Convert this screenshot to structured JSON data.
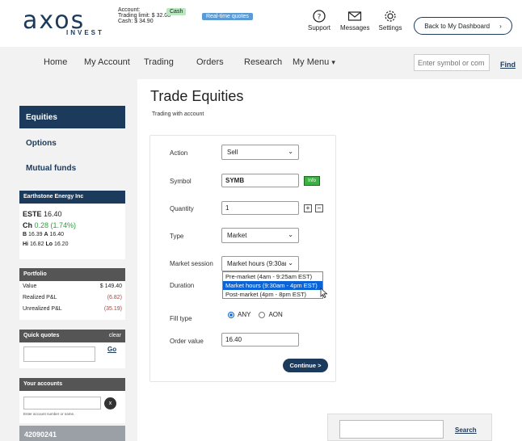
{
  "header": {
    "logo_text": "axos",
    "logo_sub": "INVEST",
    "account_label": "Account:",
    "trading_limit": "Trading limit: $ 32.08",
    "cash": "Cash: $ 34.90",
    "cash_badge": "Cash",
    "realtime_badge": "Real-time quotes",
    "support": "Support",
    "messages": "Messages",
    "settings": "Settings",
    "back_button": "Back to My Dashboard",
    "back_chevron": "›"
  },
  "nav": {
    "items": [
      "Home",
      "My Account",
      "Trading",
      "Orders",
      "Research",
      "My Menu"
    ],
    "menu_caret": "▾",
    "search_placeholder": "Enter symbol or com",
    "find": "Find"
  },
  "sidebar": {
    "items": [
      "Equities",
      "Options",
      "Mutual funds"
    ],
    "quote": {
      "header": "Earthstone Energy Inc",
      "symbol": "ESTE",
      "price": "16.40",
      "change_label": "Ch",
      "change": "0.28 (1.74%)",
      "bid_label": "B",
      "bid": "16.39",
      "ask_label": "A",
      "ask": "16.40",
      "hi_label": "Hi",
      "hi": "16.82",
      "lo_label": "Lo",
      "lo": "16.20"
    },
    "portfolio": {
      "header": "Portfolio",
      "rows": [
        {
          "label": "Value",
          "value": "$ 149.40"
        },
        {
          "label": "Realized P&L",
          "value": "(6.82)"
        },
        {
          "label": "Unrealized P&L",
          "value": "(35.19)"
        }
      ]
    },
    "quick_quotes": {
      "header": "Quick quotes",
      "clear": "clear",
      "go": "Go"
    },
    "your_accounts": {
      "header": "Your accounts",
      "clear_icon": "x",
      "hint": "Enter account number or name.",
      "account_number": "42090241"
    }
  },
  "main": {
    "title": "Trade Equities",
    "subtitle": "Trading with account",
    "form": {
      "action_label": "Action",
      "action_value": "Sell",
      "symbol_label": "Symbol",
      "symbol_value": "SYMB",
      "info_button": "Info",
      "quantity_label": "Quantity",
      "quantity_value": "1",
      "plus": "+",
      "minus": "−",
      "type_label": "Type",
      "type_value": "Market",
      "session_label": "Market session",
      "session_value": "Market hours (9:30am",
      "session_options": [
        "Pre-market (4am - 9:25am EST)",
        "Market hours (9:30am - 4pm EST)",
        "Post-market (4pm - 8pm EST)"
      ],
      "session_selected_index": 1,
      "duration_label": "Duration",
      "fill_label": "Fill type",
      "fill_options": [
        "ANY",
        "AON"
      ],
      "fill_selected": "ANY",
      "order_value_label": "Order value",
      "order_value": "16.40",
      "continue_button": "Continue >"
    },
    "bottom_search": {
      "link": "Search"
    }
  },
  "colors": {
    "brand_navy": "#1b3a5c",
    "positive": "#2e9e3e",
    "negative": "#c0392b",
    "select_blue": "#0a64d8"
  }
}
